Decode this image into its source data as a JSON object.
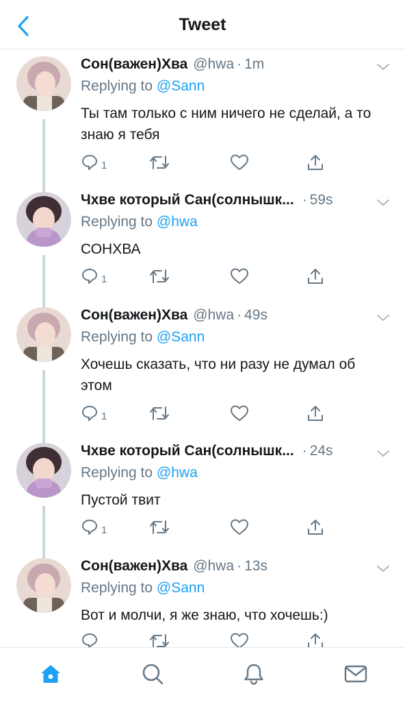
{
  "header": {
    "title": "Tweet",
    "back_icon": "chevron-left-icon"
  },
  "colors": {
    "accent": "#1da1f2",
    "secondary_text": "#657786",
    "primary_text": "#14171a",
    "thread_line": "#ccd6dd"
  },
  "tweets": [
    {
      "name": "Сон(важен)Хва",
      "handle": "@hwa",
      "dot": "·",
      "time": "1m",
      "replying_label": "Replying to",
      "replying_to": "@Sann",
      "text": "Ты там только с ним ничего не сделай, а то знаю я тебя",
      "reply_count": "1"
    },
    {
      "name": "Чхве который Сан(солнышк...",
      "handle": "",
      "dot": "·",
      "time": "59s",
      "replying_label": "Replying to",
      "replying_to": "@hwa",
      "text": "СОНХВА",
      "reply_count": "1"
    },
    {
      "name": "Сон(важен)Хва",
      "handle": "@hwa",
      "dot": "·",
      "time": "49s",
      "replying_label": "Replying to",
      "replying_to": "@Sann",
      "text": "Хочешь сказать, что ни разу не думал об этом",
      "reply_count": "1"
    },
    {
      "name": "Чхве который Сан(солнышк...",
      "handle": "",
      "dot": "·",
      "time": "24s",
      "replying_label": "Replying to",
      "replying_to": "@hwa",
      "text": "Пустой твит",
      "reply_count": "1"
    },
    {
      "name": "Сон(важен)Хва",
      "handle": "@hwa",
      "dot": "·",
      "time": "13s",
      "replying_label": "Replying to",
      "replying_to": "@Sann",
      "text": "Вот и молчи, я же знаю, что хочешь:)",
      "reply_count": ""
    }
  ],
  "tabbar": {
    "items": [
      "home-icon",
      "search-icon",
      "notifications-icon",
      "messages-icon"
    ],
    "active": "home-icon"
  }
}
